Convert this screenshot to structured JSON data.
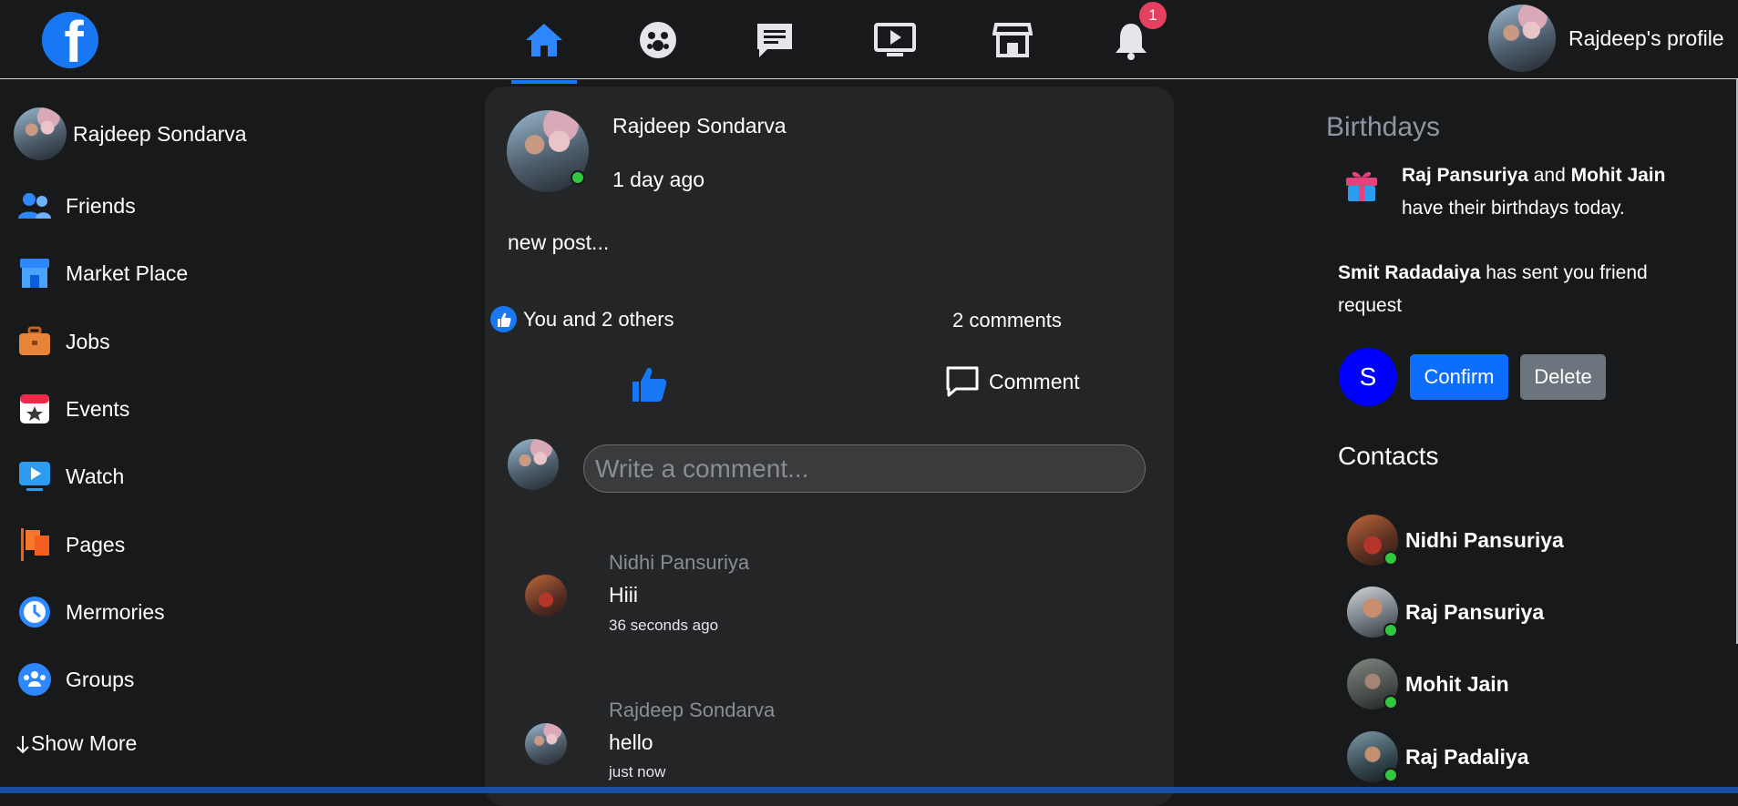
{
  "topbar": {
    "logo_letter": "f",
    "nav": [
      {
        "icon": "home-icon",
        "active": true
      },
      {
        "icon": "groups-icon",
        "active": false
      },
      {
        "icon": "messages-icon",
        "active": false
      },
      {
        "icon": "watch-icon",
        "active": false
      },
      {
        "icon": "marketplace-icon",
        "active": false
      },
      {
        "icon": "notifications-icon",
        "active": false
      }
    ],
    "notification_count": "1",
    "profile_label": "Rajdeep's profile"
  },
  "sidebar": {
    "user_name": "Rajdeep Sondarva",
    "items": [
      {
        "label": "Friends",
        "icon": "friends-icon"
      },
      {
        "label": "Market Place",
        "icon": "marketplace-icon"
      },
      {
        "label": "Jobs",
        "icon": "briefcase-icon"
      },
      {
        "label": "Events",
        "icon": "calendar-icon"
      },
      {
        "label": "Watch",
        "icon": "watch-icon"
      },
      {
        "label": "Pages",
        "icon": "flag-icon"
      },
      {
        "label": "Mermories",
        "icon": "clock-icon"
      },
      {
        "label": "Groups",
        "icon": "groups-icon"
      }
    ],
    "show_more": "Show More"
  },
  "post": {
    "author": "Rajdeep Sondarva",
    "time": "1 day ago",
    "text": "new post...",
    "likes_text": "You and 2 others",
    "comments_count": "2 comments",
    "comment_button": "Comment",
    "comment_placeholder": "Write a comment...",
    "comments": [
      {
        "name": "Nidhi Pansuriya",
        "text": "Hiii",
        "time": "36 seconds ago"
      },
      {
        "name": "Rajdeep Sondarva",
        "text": "hello",
        "time": "just now"
      }
    ]
  },
  "right": {
    "birthdays_title": "Birthdays",
    "birthday_name1": "Raj Pansuriya",
    "birthday_and": "and",
    "birthday_name2": "Mohit Jain",
    "birthday_suffix": "have their birthdays today.",
    "request_name": "Smit Radadaiya",
    "request_text": "has sent you friend",
    "request_text2": "request",
    "request_initial": "S",
    "confirm_label": "Confirm",
    "delete_label": "Delete",
    "contacts_title": "Contacts",
    "contacts": [
      "Nidhi Pansuriya",
      "Raj Pansuriya",
      "Mohit Jain",
      "Raj Padaliya"
    ]
  },
  "colors": {
    "background": "#18191a",
    "card": "#242526",
    "accent": "#1877f2",
    "online": "#31c73e",
    "badge": "#e4405f"
  }
}
